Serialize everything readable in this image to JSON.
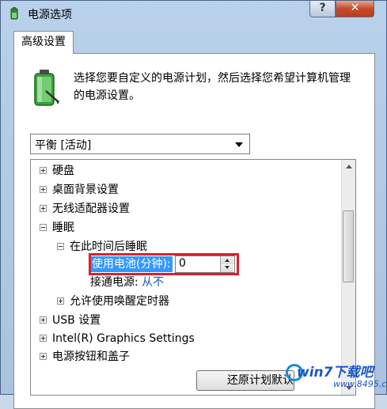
{
  "window": {
    "title": "电源选项",
    "help_glyph": "?",
    "close_glyph": "✕"
  },
  "tab": {
    "label": "高级设置"
  },
  "intro": {
    "text": "选择您要自定义的电源计划，然后选择您希望计算机管理的电源设置。"
  },
  "plan_select": {
    "value": "平衡 [活动]"
  },
  "tree": {
    "items": [
      {
        "label": "硬盘",
        "expander": "plus"
      },
      {
        "label": "桌面背景设置",
        "expander": "plus"
      },
      {
        "label": "无线适配器设置",
        "expander": "plus"
      },
      {
        "label": "睡眠",
        "expander": "minus"
      },
      {
        "label": "在此时间后睡眠",
        "expander": "minus"
      },
      {
        "label": "使用电池(分钟):",
        "value": "0"
      },
      {
        "label": "接通电源:",
        "value": "从不"
      },
      {
        "label": "允许使用唤醒定时器",
        "expander": "plus"
      },
      {
        "label": "USB 设置",
        "expander": "plus"
      },
      {
        "label": "Intel(R) Graphics Settings",
        "expander": "plus"
      },
      {
        "label": "电源按钮和盖子",
        "expander": "plus"
      }
    ]
  },
  "buttons": {
    "restore_label": "还原计划默认值"
  },
  "watermark": {
    "main": "win7下载吧",
    "url": "www.8495.com"
  },
  "colors": {
    "selection": "#3399ff",
    "highlight_box": "#d8202c",
    "link_blue": "#1a56c8"
  }
}
